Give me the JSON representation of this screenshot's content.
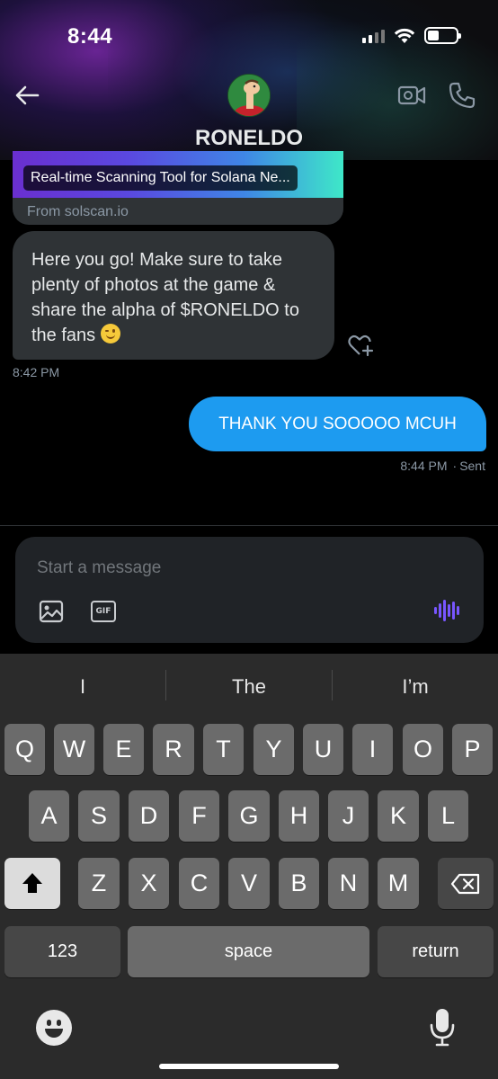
{
  "status_bar": {
    "time": "8:44",
    "icons": [
      "cellular-signal-icon",
      "wifi-icon",
      "battery-icon"
    ]
  },
  "header": {
    "contact_name": "RONELDO",
    "icons": [
      "back-arrow-icon",
      "avatar",
      "video-call-icon",
      "phone-call-icon"
    ]
  },
  "messages": {
    "link_card": {
      "title": "Real-time Scanning Tool for Solana Ne...",
      "source": "From solscan.io"
    },
    "incoming": {
      "lines": [
        "Here you go! Make sure to take",
        "plenty of photos at the game &",
        "share the alpha of $RONELDO to",
        "the fans"
      ],
      "emoji": "winking-face",
      "time": "8:42 PM"
    },
    "outgoing": {
      "text": "THANK YOU SOOOOO MCUH",
      "time": "8:44 PM",
      "separator": "·",
      "status": "Sent"
    }
  },
  "composer": {
    "placeholder": "Start a message",
    "gif_label": "GIF"
  },
  "keyboard": {
    "suggestions": [
      "I",
      "The",
      "I’m"
    ],
    "row1": [
      "Q",
      "W",
      "E",
      "R",
      "T",
      "Y",
      "U",
      "I",
      "O",
      "P"
    ],
    "row2": [
      "A",
      "S",
      "D",
      "F",
      "G",
      "H",
      "J",
      "K",
      "L"
    ],
    "row3": [
      "Z",
      "X",
      "C",
      "V",
      "B",
      "N",
      "M"
    ],
    "numbers_label": "123",
    "space_label": "space",
    "return_label": "return"
  },
  "colors": {
    "background": "#000000",
    "bubble_incoming": "#2f3336",
    "bubble_outgoing": "#1d9bf0",
    "muted_text": "#8b98a5",
    "voice_accent": "#7856ff"
  }
}
